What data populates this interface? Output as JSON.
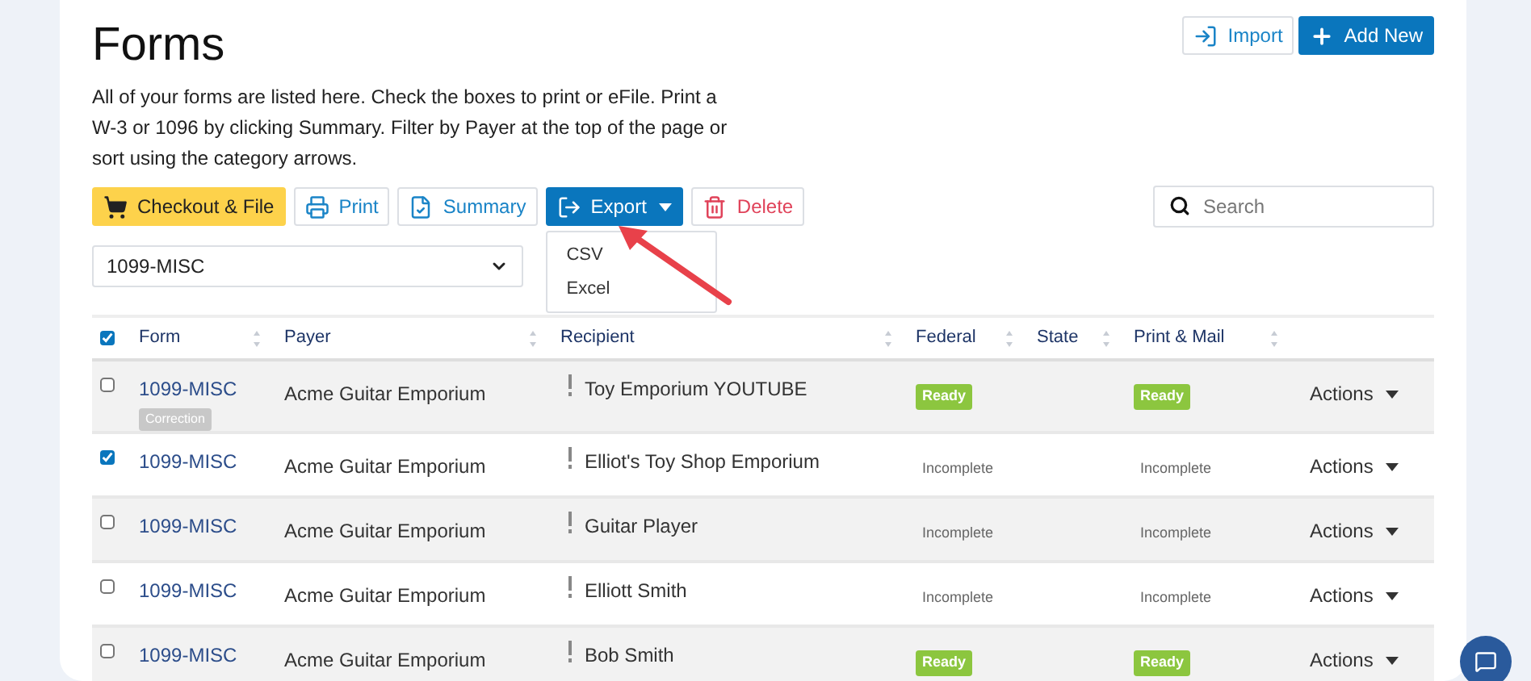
{
  "title": "Forms",
  "description": "All of your forms are listed here. Check the boxes to print or eFile. Print a W-3 or 1096 by clicking Summary. Filter by Payer at the top of the page or sort using the category arrows.",
  "header_buttons": [
    {
      "label": "Import",
      "kind": "import"
    },
    {
      "label": "Add New",
      "kind": "add"
    }
  ],
  "toolbar": [
    {
      "label": "Checkout & File",
      "kind": "checkout"
    },
    {
      "label": "Print",
      "kind": "print"
    },
    {
      "label": "Summary",
      "kind": "summary"
    },
    {
      "label": "Export",
      "kind": "export",
      "expanded": true,
      "menu": [
        "CSV",
        "Excel"
      ]
    },
    {
      "label": "Delete",
      "kind": "delete"
    }
  ],
  "search": {
    "placeholder": "Search"
  },
  "filter": {
    "value": "1099-MISC"
  },
  "table": {
    "all_checked": true,
    "columns": [
      "Form",
      "Payer",
      "Recipient",
      "Federal",
      "State",
      "Print & Mail"
    ],
    "rows": [
      {
        "selected": false,
        "form": "1099-MISC",
        "tag": "Correction",
        "payer": "Acme Guitar Emporium",
        "recipient": "Toy Emporium YOUTUBE",
        "federal": {
          "text": "Ready",
          "kind": "ready"
        },
        "print_mail": {
          "text": "Ready",
          "kind": "ready"
        },
        "actions": "Actions"
      },
      {
        "selected": true,
        "form": "1099-MISC",
        "payer": "Acme Guitar Emporium",
        "recipient": "Elliot's Toy Shop Emporium",
        "federal": {
          "text": "Incomplete",
          "kind": "incomplete"
        },
        "print_mail": {
          "text": "Incomplete",
          "kind": "incomplete"
        },
        "actions": "Actions"
      },
      {
        "selected": false,
        "form": "1099-MISC",
        "payer": "Acme Guitar Emporium",
        "recipient": "Guitar Player",
        "federal": {
          "text": "Incomplete",
          "kind": "incomplete"
        },
        "print_mail": {
          "text": "Incomplete",
          "kind": "incomplete"
        },
        "actions": "Actions"
      },
      {
        "selected": false,
        "form": "1099-MISC",
        "payer": "Acme Guitar Emporium",
        "recipient": "Elliott Smith",
        "federal": {
          "text": "Incomplete",
          "kind": "incomplete"
        },
        "print_mail": {
          "text": "Incomplete",
          "kind": "incomplete"
        },
        "actions": "Actions"
      },
      {
        "selected": false,
        "form": "1099-MISC",
        "payer": "Acme Guitar Emporium",
        "recipient": "Bob Smith",
        "federal": {
          "text": "Ready",
          "kind": "ready"
        },
        "print_mail": {
          "text": "Ready",
          "kind": "ready"
        },
        "actions": "Actions"
      }
    ]
  }
}
